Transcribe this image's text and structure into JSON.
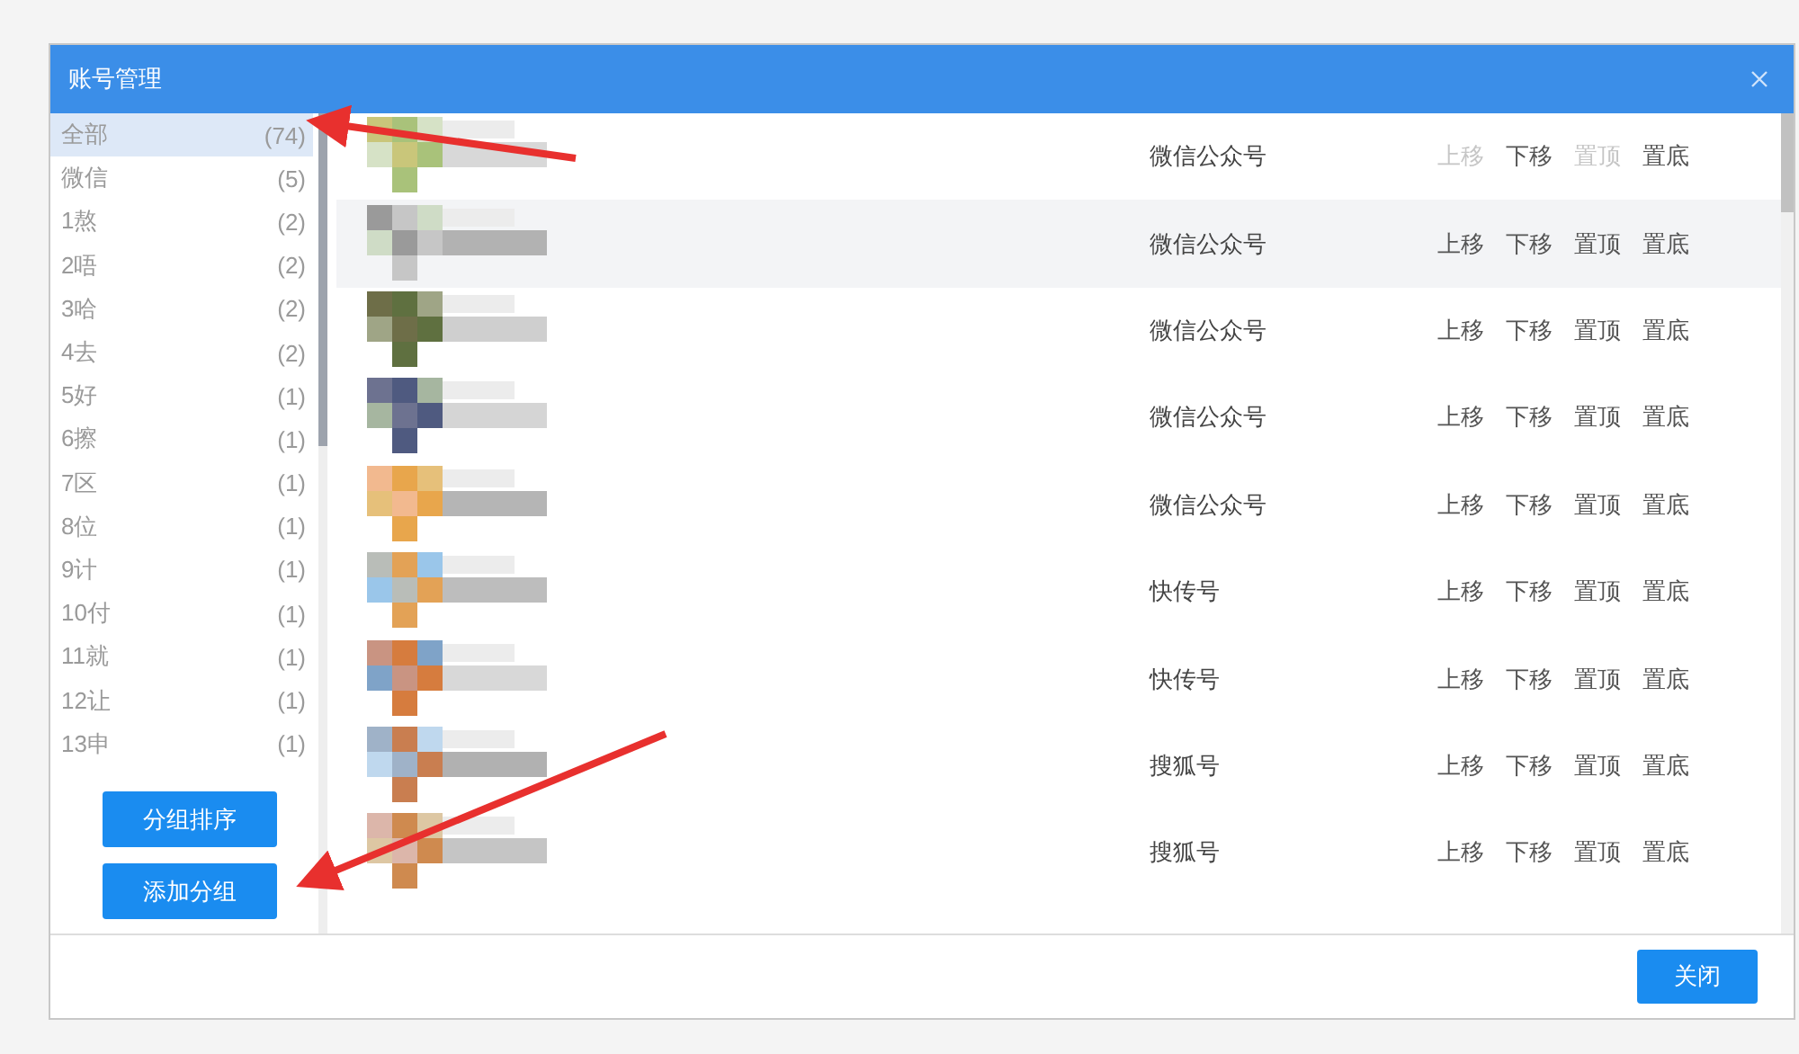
{
  "window": {
    "title": "账号管理"
  },
  "sidebar": {
    "items": [
      {
        "label": "全部",
        "count": "(74)",
        "selected": true
      },
      {
        "label": "微信",
        "count": "(5)",
        "selected": false
      },
      {
        "label": "1熬",
        "count": "(2)",
        "selected": false
      },
      {
        "label": "2唔",
        "count": "(2)",
        "selected": false
      },
      {
        "label": "3哈",
        "count": "(2)",
        "selected": false
      },
      {
        "label": "4去",
        "count": "(2)",
        "selected": false
      },
      {
        "label": "5好",
        "count": "(1)",
        "selected": false
      },
      {
        "label": "6擦",
        "count": "(1)",
        "selected": false
      },
      {
        "label": "7区",
        "count": "(1)",
        "selected": false
      },
      {
        "label": "8位",
        "count": "(1)",
        "selected": false
      },
      {
        "label": "9计",
        "count": "(1)",
        "selected": false
      },
      {
        "label": "10付",
        "count": "(1)",
        "selected": false
      },
      {
        "label": "11就",
        "count": "(1)",
        "selected": false
      },
      {
        "label": "12让",
        "count": "(1)",
        "selected": false
      },
      {
        "label": "13申",
        "count": "(1)",
        "selected": false
      }
    ],
    "buttons": [
      "分组排序",
      "添加分组"
    ]
  },
  "accounts": [
    {
      "type": "微信公众号",
      "highlighted": false,
      "actions": [
        {
          "label": "上移",
          "disabled": true
        },
        {
          "label": "下移",
          "disabled": false
        },
        {
          "label": "置顶",
          "disabled": true
        },
        {
          "label": "置底",
          "disabled": false
        }
      ]
    },
    {
      "type": "微信公众号",
      "highlighted": true,
      "actions": [
        {
          "label": "上移",
          "disabled": false
        },
        {
          "label": "下移",
          "disabled": false
        },
        {
          "label": "置顶",
          "disabled": false
        },
        {
          "label": "置底",
          "disabled": false
        }
      ]
    },
    {
      "type": "微信公众号",
      "highlighted": false,
      "actions": [
        {
          "label": "上移",
          "disabled": false
        },
        {
          "label": "下移",
          "disabled": false
        },
        {
          "label": "置顶",
          "disabled": false
        },
        {
          "label": "置底",
          "disabled": false
        }
      ]
    },
    {
      "type": "微信公众号",
      "highlighted": false,
      "actions": [
        {
          "label": "上移",
          "disabled": false
        },
        {
          "label": "下移",
          "disabled": false
        },
        {
          "label": "置顶",
          "disabled": false
        },
        {
          "label": "置底",
          "disabled": false
        }
      ]
    },
    {
      "type": "微信公众号",
      "highlighted": false,
      "actions": [
        {
          "label": "上移",
          "disabled": false
        },
        {
          "label": "下移",
          "disabled": false
        },
        {
          "label": "置顶",
          "disabled": false
        },
        {
          "label": "置底",
          "disabled": false
        }
      ]
    },
    {
      "type": "快传号",
      "highlighted": false,
      "actions": [
        {
          "label": "上移",
          "disabled": false
        },
        {
          "label": "下移",
          "disabled": false
        },
        {
          "label": "置顶",
          "disabled": false
        },
        {
          "label": "置底",
          "disabled": false
        }
      ]
    },
    {
      "type": "快传号",
      "highlighted": false,
      "actions": [
        {
          "label": "上移",
          "disabled": false
        },
        {
          "label": "下移",
          "disabled": false
        },
        {
          "label": "置顶",
          "disabled": false
        },
        {
          "label": "置底",
          "disabled": false
        }
      ]
    },
    {
      "type": "搜狐号",
      "highlighted": false,
      "actions": [
        {
          "label": "上移",
          "disabled": false
        },
        {
          "label": "下移",
          "disabled": false
        },
        {
          "label": "置顶",
          "disabled": false
        },
        {
          "label": "置底",
          "disabled": false
        }
      ]
    },
    {
      "type": "搜狐号",
      "highlighted": false,
      "actions": [
        {
          "label": "上移",
          "disabled": false
        },
        {
          "label": "下移",
          "disabled": false
        },
        {
          "label": "置顶",
          "disabled": false
        },
        {
          "label": "置底",
          "disabled": false
        }
      ]
    }
  ],
  "footer": {
    "button": "关闭"
  }
}
